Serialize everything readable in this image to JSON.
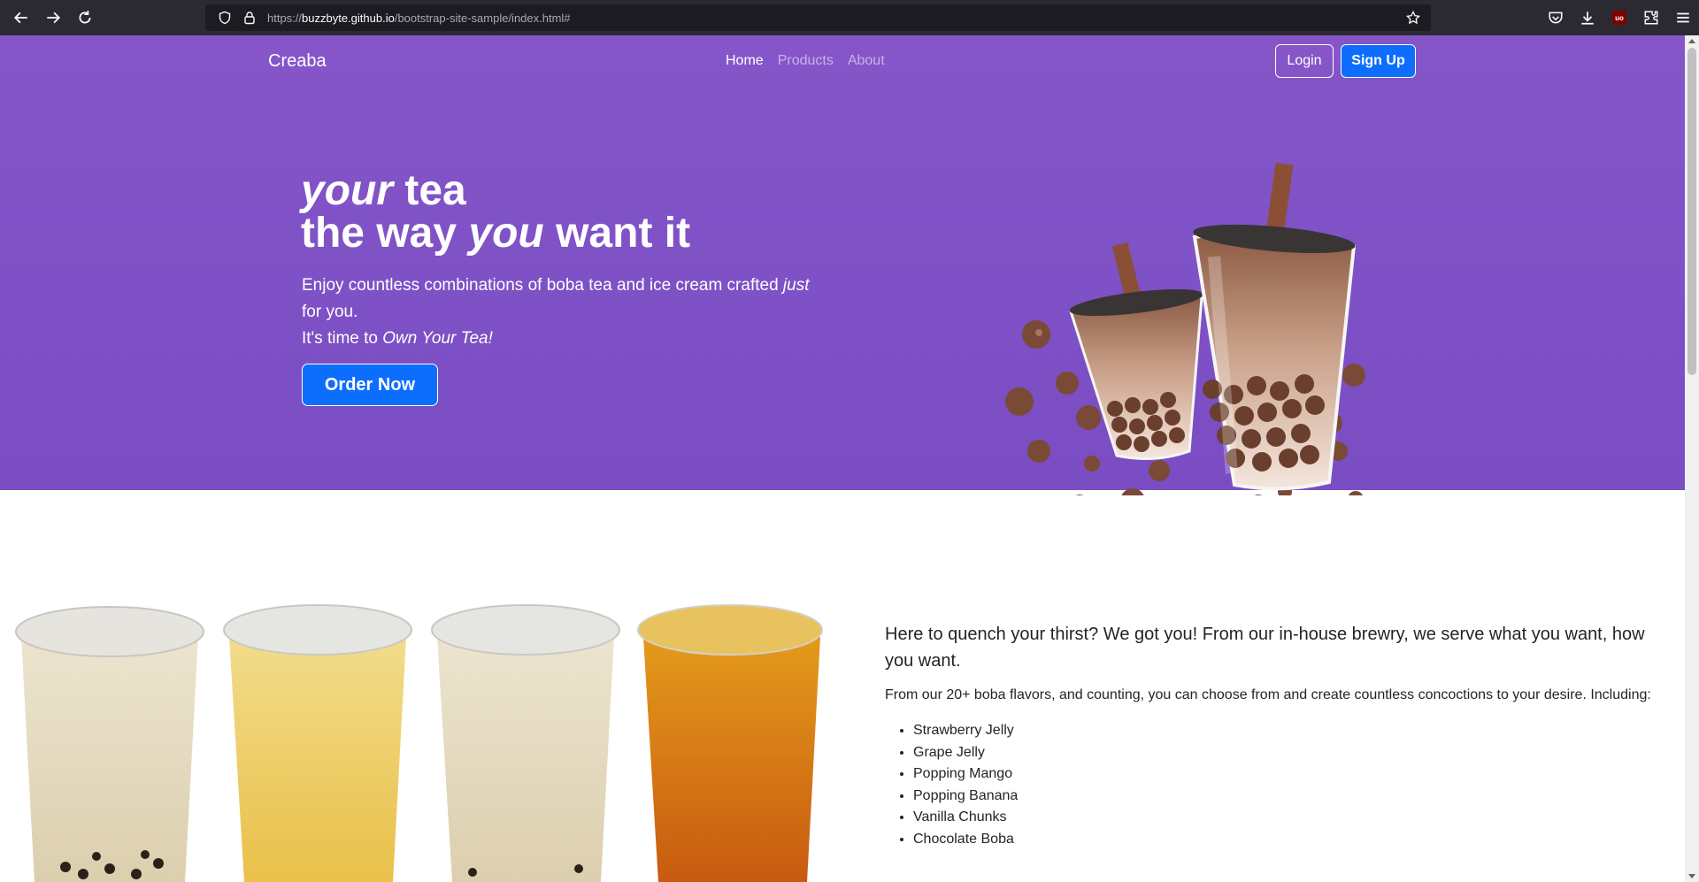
{
  "browser": {
    "url_prefix": "https://",
    "url_host": "buzzbyte.github.io",
    "url_path": "/bootstrap-site-sample/index.html#"
  },
  "navbar": {
    "brand": "Creaba",
    "links": [
      {
        "label": "Home"
      },
      {
        "label": "Products"
      },
      {
        "label": "About"
      }
    ],
    "login_label": "Login",
    "signup_label": "Sign Up"
  },
  "hero": {
    "title_line1_em": "your",
    "title_line1_rest": " tea",
    "title_line2_a": "the way ",
    "title_line2_em": "you",
    "title_line2_b": " want it",
    "subtitle_a": "Enjoy countless combinations of boba tea and ice cream crafted ",
    "subtitle_em": "just",
    "subtitle_b": " for you.",
    "subtitle2_a": "It's time to ",
    "subtitle2_em": "Own Your Tea!",
    "order_label": "Order Now"
  },
  "content": {
    "lead": "Here to quench your thirst? We got you! From our in-house brewry, we serve what you want, how you want.",
    "paragraph": "From our 20+ boba flavors, and counting, you can choose from and create countless concoctions to your desire. Including:",
    "flavors": [
      "Strawberry Jelly",
      "Grape Jelly",
      "Popping Mango",
      "Popping Banana",
      "Vanilla Chunks",
      "Chocolate Boba"
    ]
  },
  "colors": {
    "hero_bg": "#7f52c6",
    "primary_button": "#0d6efd"
  }
}
